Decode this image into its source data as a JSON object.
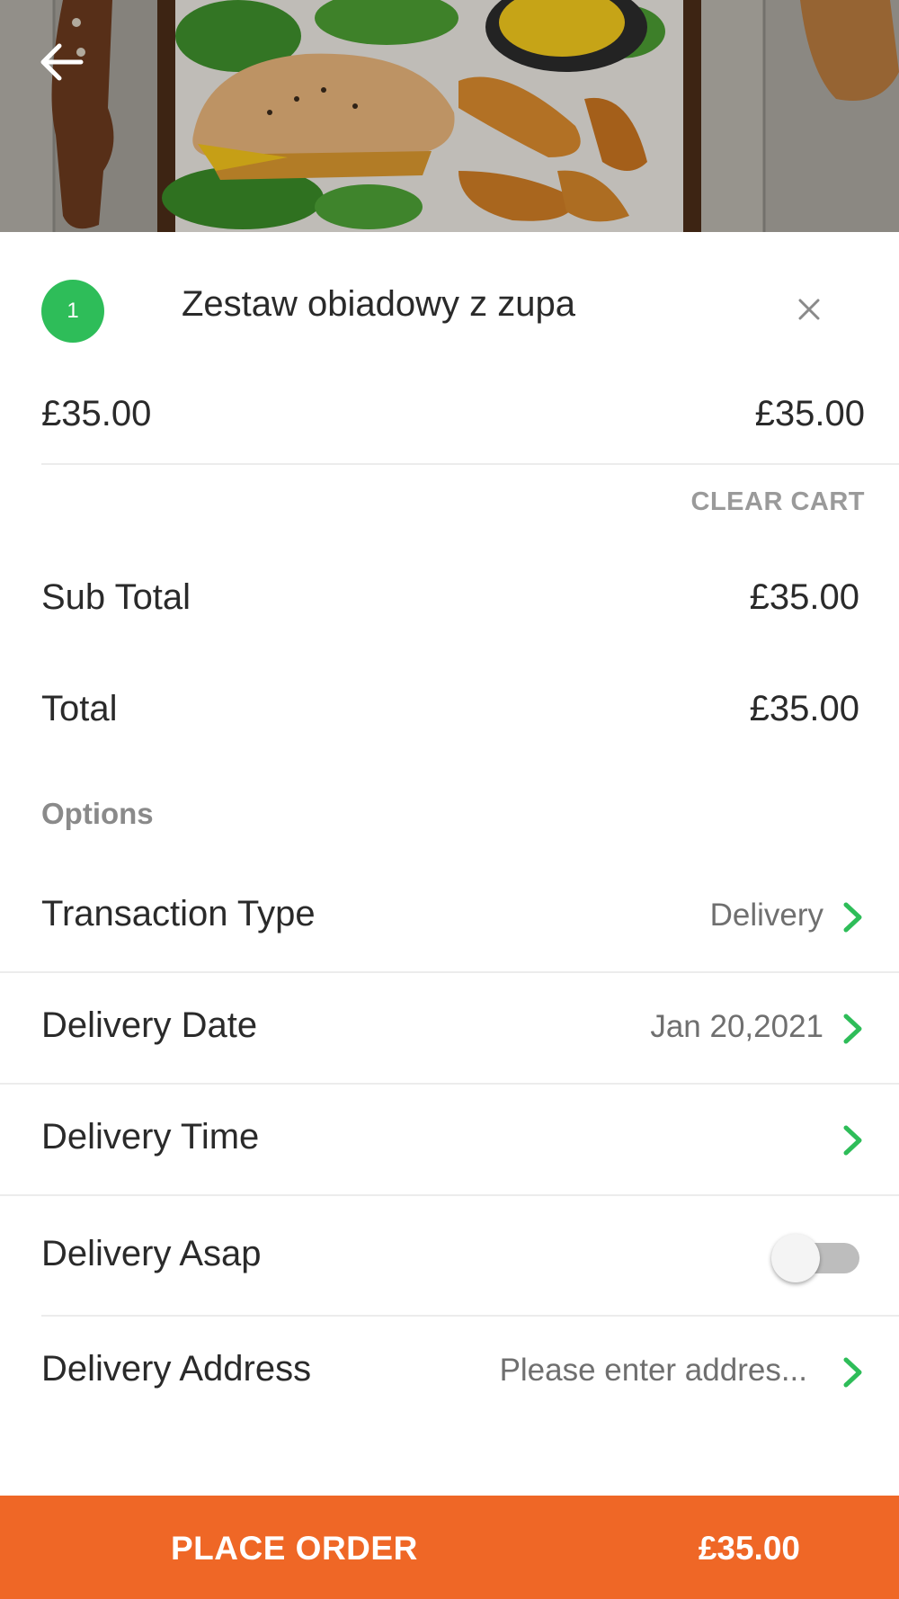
{
  "header": {
    "back_icon": "arrow-left-icon",
    "image": "food-photo: sandwich, potato wedges, corn on a wooden board"
  },
  "cart": {
    "items": [
      {
        "quantity": "1",
        "name": "Zestaw obiadowy z zupa",
        "unit_price": "£35.00",
        "line_price": "£35.00",
        "remove_icon": "close-icon"
      }
    ],
    "clear_cart_label": "CLEAR CART"
  },
  "summary": {
    "subtotal_label": "Sub Total",
    "subtotal_value": "£35.00",
    "total_label": "Total",
    "total_value": "£35.00"
  },
  "options": {
    "heading": "Options",
    "transaction_type": {
      "label": "Transaction Type",
      "value": "Delivery"
    },
    "delivery_date": {
      "label": "Delivery Date",
      "value": "Jan 20,2021"
    },
    "delivery_time": {
      "label": "Delivery Time",
      "value": ""
    },
    "delivery_asap": {
      "label": "Delivery Asap",
      "enabled": false
    },
    "delivery_address": {
      "label": "Delivery Address",
      "placeholder": "Please enter addres..."
    }
  },
  "place_order": {
    "label": "PLACE ORDER",
    "amount": "£35.00"
  },
  "colors": {
    "accent_green": "#2ebd59",
    "order_button": "#ef6726",
    "muted_text": "#9a9a9a"
  }
}
